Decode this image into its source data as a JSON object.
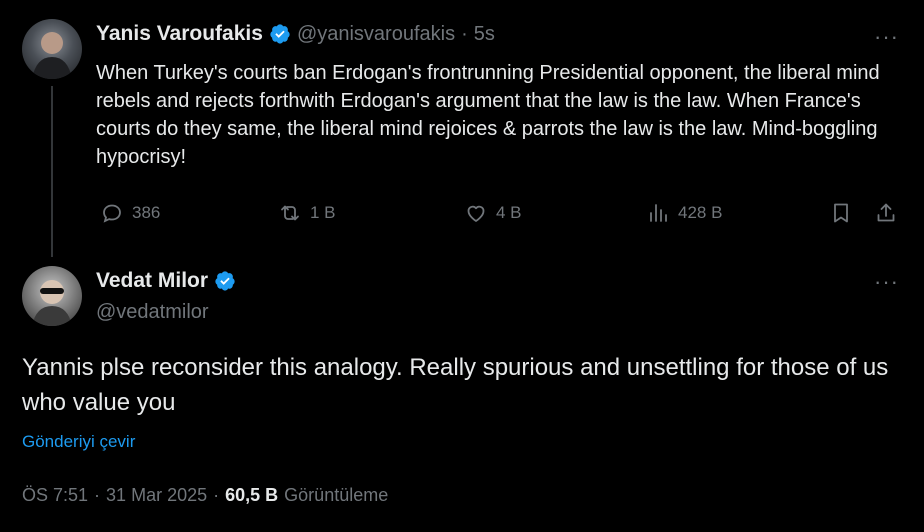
{
  "original_tweet": {
    "author_name": "Yanis Varoufakis",
    "handle": "@yanisvaroufakis",
    "separator": "·",
    "time_ago": "5s",
    "text": "When Turkey's courts ban Erdogan's frontrunning Presidential opponent, the liberal mind rebels and rejects forthwith Erdogan's argument that the law is the law. When France's courts do they same, the liberal mind rejoices & parrots the law is the law. Mind-boggling hypocrisy!",
    "more_label": "···",
    "actions": {
      "replies": "386",
      "reposts": "1 B",
      "likes": "4 B",
      "views": "428 B"
    }
  },
  "reply_tweet": {
    "author_name": "Vedat Milor",
    "handle": "@vedatmilor",
    "more_label": "···",
    "text": "Yannis plse reconsider this analogy. Really spurious and unsettling for those of us who value you",
    "translate_label": "Gönderiyi çevir",
    "time": "ÖS 7:51",
    "date": "31 Mar 2025",
    "view_count": "60,5 B",
    "views_label": "Görüntüleme",
    "separator": "·"
  },
  "colors": {
    "background": "#000000",
    "text": "#e7e9ea",
    "muted": "#71767b",
    "accent": "#1d9bf0"
  },
  "icons": [
    "verified-badge-icon",
    "reply-icon",
    "repost-icon",
    "like-icon",
    "views-icon",
    "bookmark-icon",
    "share-icon",
    "more-icon"
  ]
}
